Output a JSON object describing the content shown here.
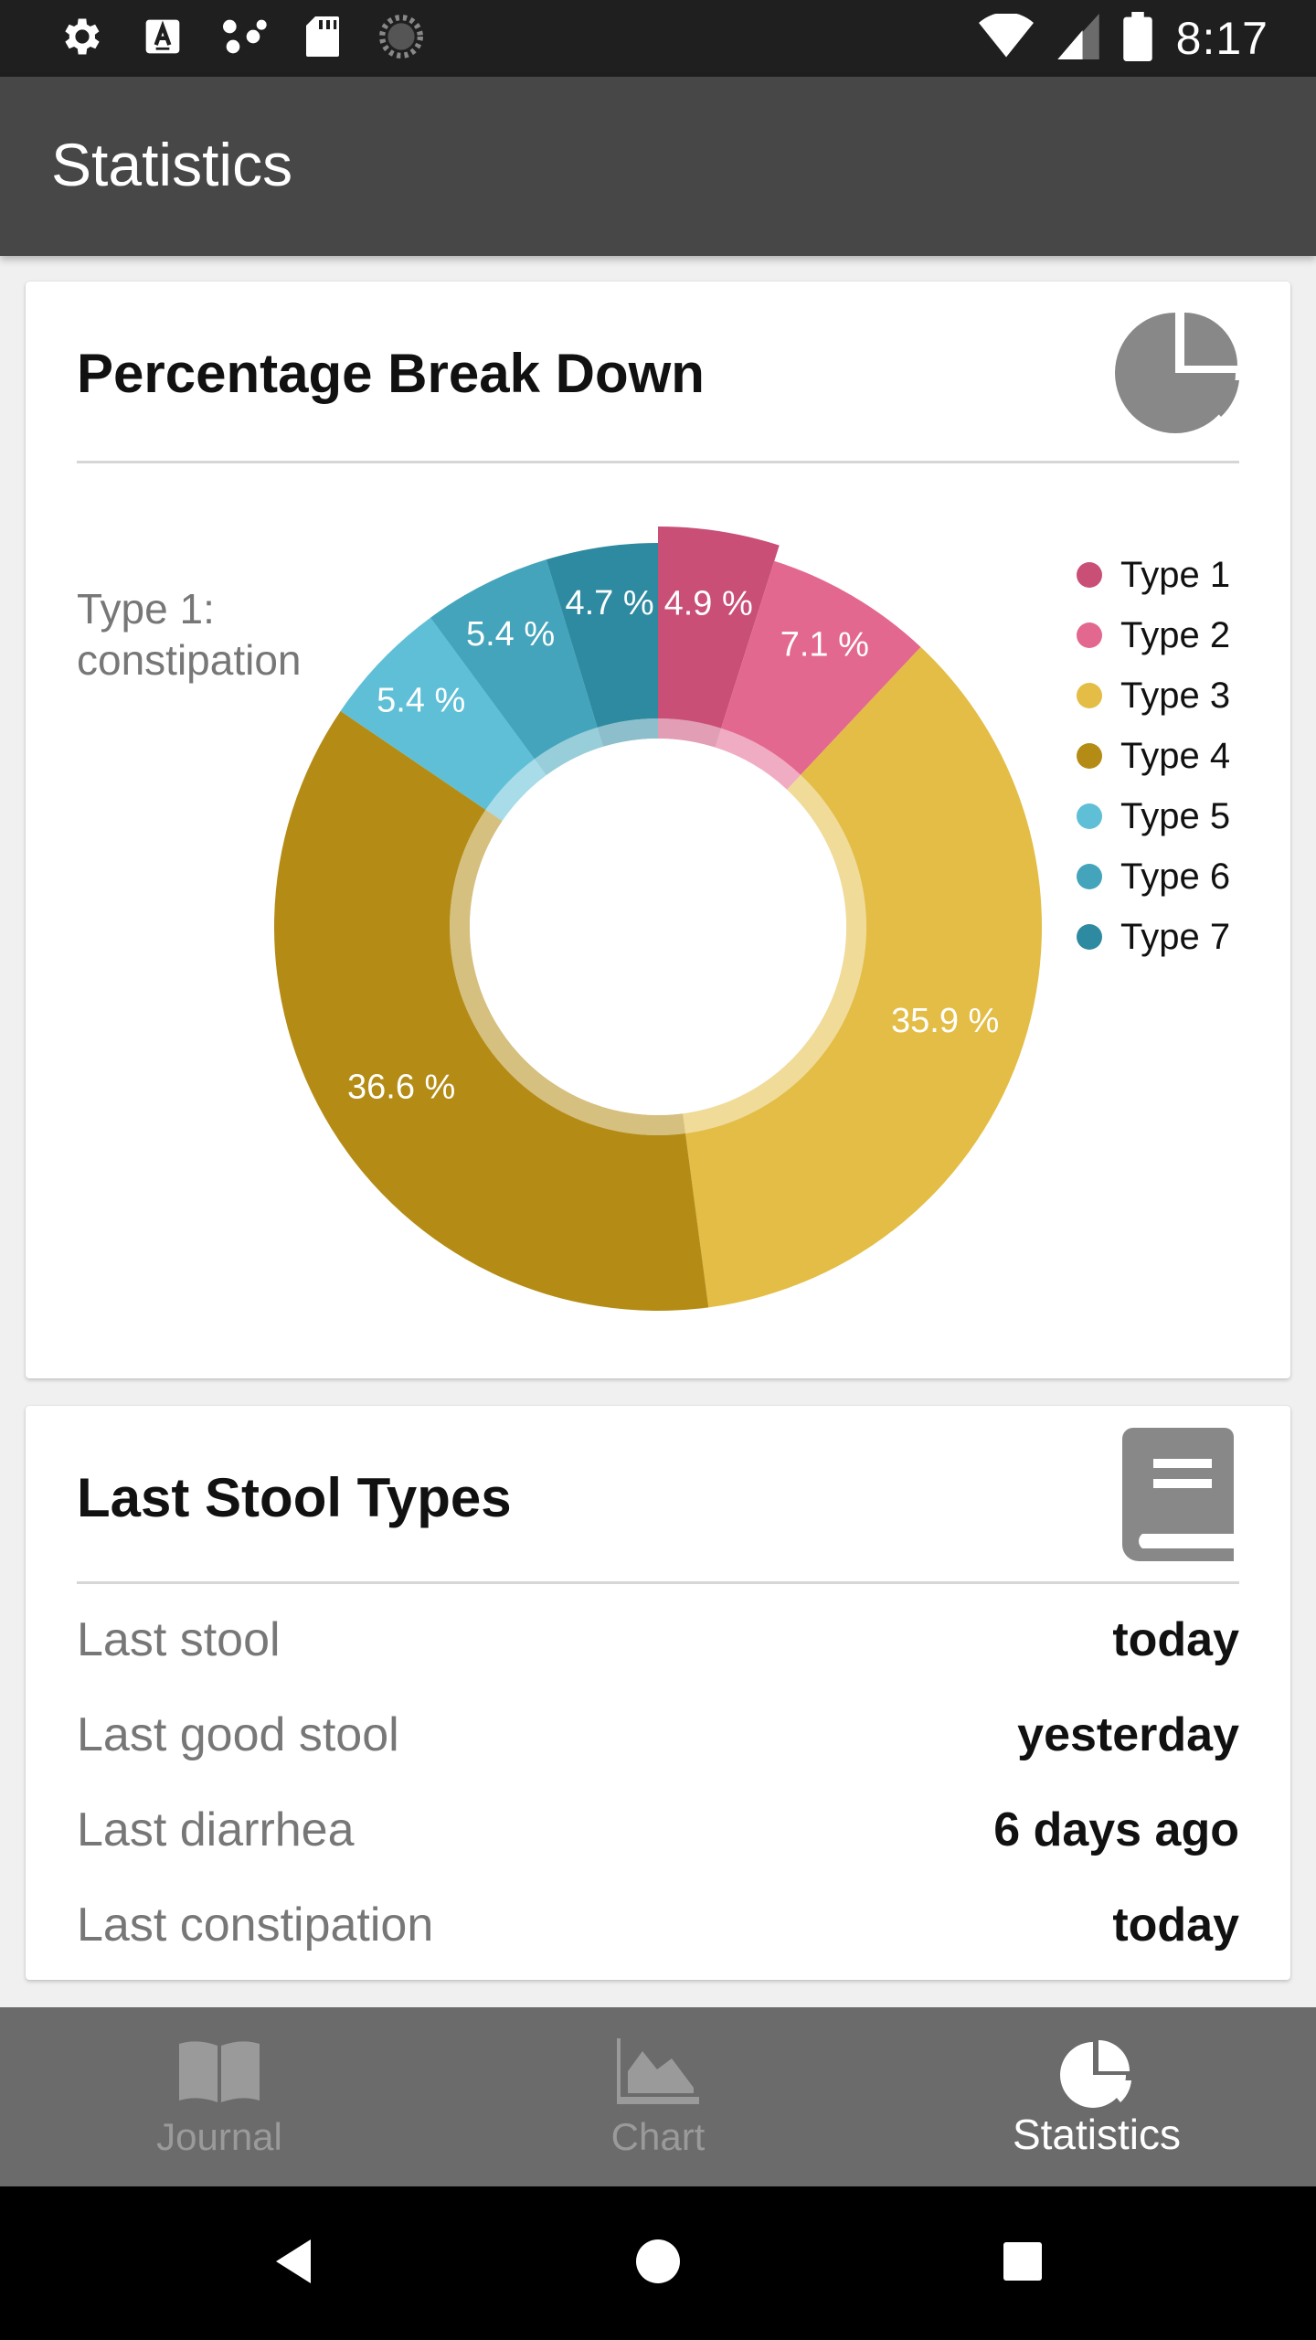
{
  "status_bar": {
    "time": "8:17",
    "left_icons": [
      "settings-icon",
      "a-icon",
      "connection-icon",
      "sd-card-icon",
      "spinner-icon"
    ],
    "right_icons": [
      "wifi-icon",
      "cellular-icon",
      "battery-icon"
    ]
  },
  "app_bar": {
    "title": "Statistics"
  },
  "percentage_card": {
    "title": "Percentage Break Down",
    "icon": "pie-chart-icon",
    "center_label_line1": "Type 1:",
    "center_label_line2": "constipation"
  },
  "chart_data": {
    "type": "pie",
    "donut": true,
    "categories": [
      "Type 1",
      "Type 2",
      "Type 3",
      "Type 4",
      "Type 5",
      "Type 6",
      "Type 7"
    ],
    "values": [
      4.9,
      7.1,
      35.9,
      36.6,
      5.4,
      5.4,
      4.7
    ],
    "labels": [
      "4.9 %",
      "7.1 %",
      "35.9 %",
      "36.6 %",
      "5.4 %",
      "5.4 %",
      "4.7 %"
    ],
    "colors": [
      "#c94f77",
      "#e3688f",
      "#e3bd45",
      "#b48c15",
      "#5ebfd6",
      "#43a4bc",
      "#2e8aa0"
    ],
    "highlighted": "Type 1",
    "legend_position": "right"
  },
  "stool_card": {
    "title": "Last Stool Types",
    "icon": "book-icon",
    "rows": [
      {
        "label": "Last stool",
        "value": "today"
      },
      {
        "label": "Last good stool",
        "value": "yesterday"
      },
      {
        "label": "Last diarrhea",
        "value": "6 days ago"
      },
      {
        "label": "Last constipation",
        "value": "today"
      }
    ]
  },
  "bottom_nav": {
    "items": [
      {
        "label": "Journal",
        "icon": "book-open-icon",
        "active": false
      },
      {
        "label": "Chart",
        "icon": "area-chart-icon",
        "active": false
      },
      {
        "label": "Statistics",
        "icon": "pie-chart-icon",
        "active": true
      }
    ]
  },
  "system_nav": {
    "icons": [
      "back-icon",
      "home-icon",
      "recents-icon"
    ]
  }
}
